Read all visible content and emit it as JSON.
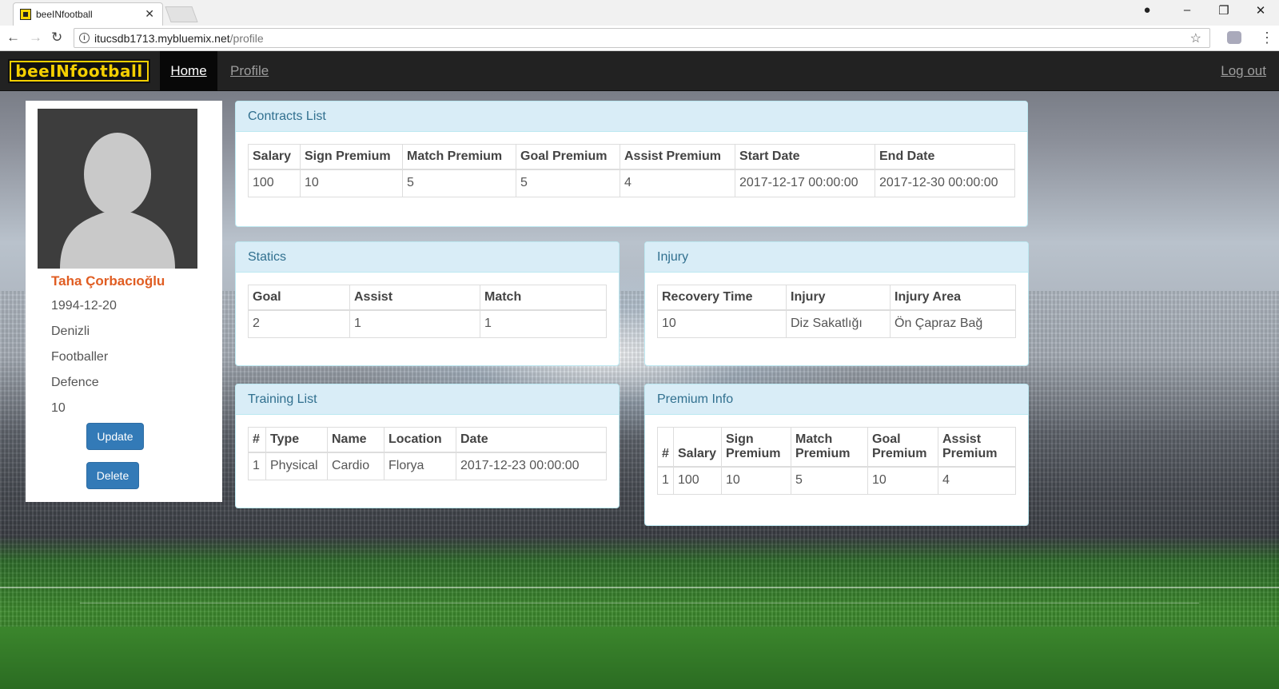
{
  "browser": {
    "tab_title": "beeINfootball",
    "url_host": "itucsdb1713.mybluemix.net",
    "url_path": "/profile"
  },
  "navbar": {
    "brand": "beeINfootball",
    "home": "Home",
    "profile": "Profile",
    "logout": "Log out"
  },
  "player": {
    "name": "Taha Çorbacıoğlu",
    "birth_date": "1994-12-20",
    "city": "Denizli",
    "role": "Footballer",
    "position": "Defence",
    "number": "10",
    "update_label": "Update",
    "delete_label": "Delete"
  },
  "contracts": {
    "title": "Contracts List",
    "headers": [
      "Salary",
      "Sign Premium",
      "Match Premium",
      "Goal Premium",
      "Assist Premium",
      "Start Date",
      "End Date"
    ],
    "rows": [
      [
        "100",
        "10",
        "5",
        "5",
        "4",
        "2017-12-17 00:00:00",
        "2017-12-30 00:00:00"
      ]
    ]
  },
  "statics": {
    "title": "Statics",
    "headers": [
      "Goal",
      "Assist",
      "Match"
    ],
    "rows": [
      [
        "2",
        "1",
        "1"
      ]
    ]
  },
  "injury": {
    "title": "Injury",
    "headers": [
      "Recovery Time",
      "Injury",
      "Injury Area"
    ],
    "rows": [
      [
        "10",
        "Diz Sakatlığı",
        "Ön Çapraz Bağ"
      ]
    ]
  },
  "training": {
    "title": "Training List",
    "headers": [
      "#",
      "Type",
      "Name",
      "Location",
      "Date"
    ],
    "rows": [
      [
        "1",
        "Physical",
        "Cardio",
        "Florya",
        "2017-12-23 00:00:00"
      ]
    ]
  },
  "premium": {
    "title": "Premium Info",
    "headers": [
      "#",
      "Salary",
      "Sign Premium",
      "Match Premium",
      "Goal Premium",
      "Assist Premium"
    ],
    "rows": [
      [
        "1",
        "100",
        "10",
        "5",
        "10",
        "4"
      ]
    ]
  }
}
